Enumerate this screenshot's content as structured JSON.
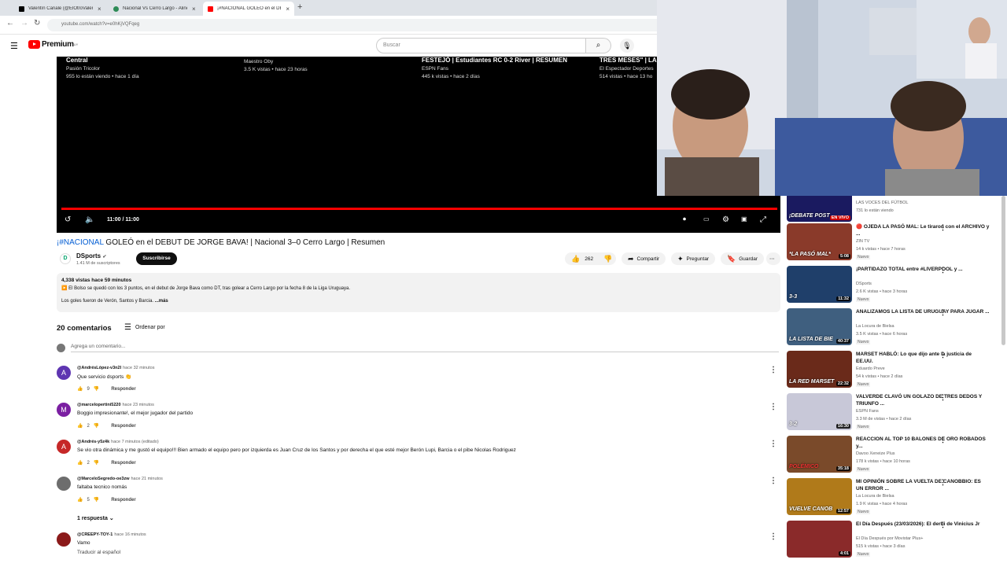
{
  "browser": {
    "tabs": [
      {
        "title": "Valentín Canale (@ElOtroValen",
        "close": "×",
        "color": "#000000"
      },
      {
        "title": "Nacional Vs Cerro Largo - Alinea",
        "close": "×",
        "color": "#2e8b57"
      },
      {
        "title": "¡#NACIONAL GOLEÓ en el DEB",
        "close": "×",
        "color": "#ff0000"
      }
    ],
    "new_tab": "+",
    "url": "youtube.com/watch?v=e0hKjVQFqeg"
  },
  "header": {
    "logo_text": "Premium",
    "logo_sup": "UY",
    "search_placeholder": "Buscar"
  },
  "player": {
    "endcards": [
      {
        "title": "Central",
        "line1": "Pasión Tricolor",
        "line2": "955 lo están viendo • hace 1 día"
      },
      {
        "title": "",
        "line1": "Maestro Oby",
        "line2": "3.5 K vistas • hace 23 horas"
      },
      {
        "title": "FESTEJÓ | Estudiantes RC 0-2 River | RESUMEN",
        "line1": "ESPN Fans",
        "line2": "445 k vistas • hace 2 días"
      },
      {
        "title": "TRES MESES\" | LA M",
        "line1": "El Espectador Deportes",
        "line2": "514 vistas • hace 13 ho"
      }
    ],
    "time": "11:00 / 11:00",
    "progress": 1.0
  },
  "video": {
    "title_tag": "¡#NACIONAL",
    "title_rest": " GOLEÓ en el DEBUT DE JORGE BAVA! | Nacional 3–0 Cerro Largo | Resumen",
    "channel_name": "DSports",
    "channel_initial": "D",
    "subscribers": "1.41 M de suscriptores",
    "subscribe_label": "Suscribirse",
    "likes": "262",
    "share_label": "Compartir",
    "ask_label": "Preguntar",
    "save_label": "Guardar",
    "desc_views": "4,338 vistas  hace 59 minutos",
    "desc_line1": "▶️ El Bolso se quedó con los 3 puntos, en el debut de Jorge Bava como DT, tras golear a Cerro Largo por la fecha 8 de la Liga Uruguaya.",
    "desc_line2": "Los goles fueron de Verón, Santos y Barcia.",
    "desc_more": "...más"
  },
  "comments": {
    "count_label": "20 comentarios",
    "sort_label": "Ordenar por",
    "add_placeholder": "Agrega un comentario...",
    "reply_label": "Responder",
    "replies_label": "1 respuesta",
    "items": [
      {
        "initial": "A",
        "color": "#5e35b1",
        "handle": "@AndrésLópez-v3n2l",
        "time": "hace 32 minutos",
        "text": "Que servicio dsports 👏",
        "likes": "9"
      },
      {
        "initial": "M",
        "color": "#7b1fa2",
        "handle": "@marcelopertini5220",
        "time": "hace 23 minutos",
        "text": "Boggio impresionante!, el mejor jugador del partido",
        "likes": "2"
      },
      {
        "initial": "A",
        "color": "#c62828",
        "handle": "@Andrés-y5z4k",
        "time": "hace 7 minutos (editado)",
        "text": "Se vio otra dinámica y me gustó el equipo!!! Bien armado el equipo pero por izquierda es Juan Cruz de los Santos y por derecha el que esté mejor Berón Lupi, Barcia o el pibe Nicolas Rodriguez",
        "likes": "2"
      },
      {
        "initial": "",
        "color": "#6d6d6d",
        "handle": "@MarceloSegredo-oe3zw",
        "time": "hace 21 minutos",
        "text": "faltaba tecnico nomás",
        "likes": "5"
      },
      {
        "initial": "",
        "color": "#8b1a1a",
        "handle": "@CREEPY-TOY-1",
        "time": "hace 16 minutos",
        "text": "Vamo",
        "text2": "Traducir al español",
        "likes": ""
      }
    ]
  },
  "sidebar": {
    "items": [
      {
        "title": "",
        "channel": "LAS VOCES DEL FÚTBOL",
        "meta": "731 lo están viendo",
        "thumb_text": "¡DEBATE POST",
        "badge": "",
        "duration": "EN VIVO",
        "bg": "#1a1a60"
      },
      {
        "title": "🔴 OJEDA LA PASÓ MAL: Le tiraron con el ARCHIVO y ...",
        "channel": "ZIN TV",
        "meta": "14 k vistas • hace 7 horas",
        "thumb_text": "*LA PASÓ MAL*",
        "badge": "Nuevo",
        "duration": "5:08",
        "bg": "#8a3a2a"
      },
      {
        "title": "¡PARTIDAZO TOTAL entre #LIVERPOOL y ...",
        "channel": "DSports",
        "meta": "2.6 K vistas • hace 3 horas",
        "thumb_text": "3-3",
        "badge": "Nuevo",
        "duration": "11:32",
        "bg": "#1f3f6a"
      },
      {
        "title": "ANALIZAMOS LA LISTA DE URUGUAY PARA JUGAR ...",
        "channel": "La Locura de Bielsa",
        "meta": "3.5 K vistas • hace 6 horas",
        "thumb_text": "LA LISTA DE BIE",
        "badge": "Nuevo",
        "duration": "40:37",
        "bg": "#3f5f7f"
      },
      {
        "title": "MARSET HABLÓ: Lo que dijo ante la justicia de EE.UU.",
        "channel": "Eduardo Preve",
        "meta": "54 k vistas • hace 2 días",
        "thumb_text": "LA RED MARSET",
        "badge": "Nuevo",
        "duration": "22:32",
        "bg": "#6a2a1a"
      },
      {
        "title": "VALVERDE CLAVÓ UN GOLAZO DE TRES DEDOS Y TRIUNFO ...",
        "channel": "ESPN Fans",
        "meta": "3.3 M de vistas • hace 2 días",
        "thumb_text": "3-2",
        "badge": "Nuevo",
        "duration": "16:30",
        "bg": "#d8d8e8"
      },
      {
        "title": "REACCION AL TOP 10 BALONES DE ORO ROBADOS y...",
        "channel": "Davoo Xeneize Plus",
        "meta": "178 k vistas • hace 10 horas",
        "thumb_text": "POLÉMICO",
        "badge": "Nuevo",
        "duration": "35:18",
        "bg": "#7a4a2a"
      },
      {
        "title": "MI OPINIÓN SOBRE LA VUELTA DE CANOBBIO: ES UN ERROR ...",
        "channel": "La Locura de Bielsa",
        "meta": "1.9 K vistas • hace 4 horas",
        "thumb_text": "VUELVE CANOB",
        "badge": "Nuevo",
        "duration": "12:57",
        "bg": "#b07a1a"
      },
      {
        "title": "El Día Después (23/03/2026): El derbi de Vinicius Jr",
        "channel": "El Día Después por Movistar Plus+",
        "meta": "515 k vistas • hace 3 días",
        "thumb_text": "",
        "badge": "Nuevo",
        "duration": "4:01",
        "bg": "#8a2a2a"
      }
    ]
  },
  "colors": {
    "accent": "#ff0000",
    "link": "#065fd4"
  }
}
